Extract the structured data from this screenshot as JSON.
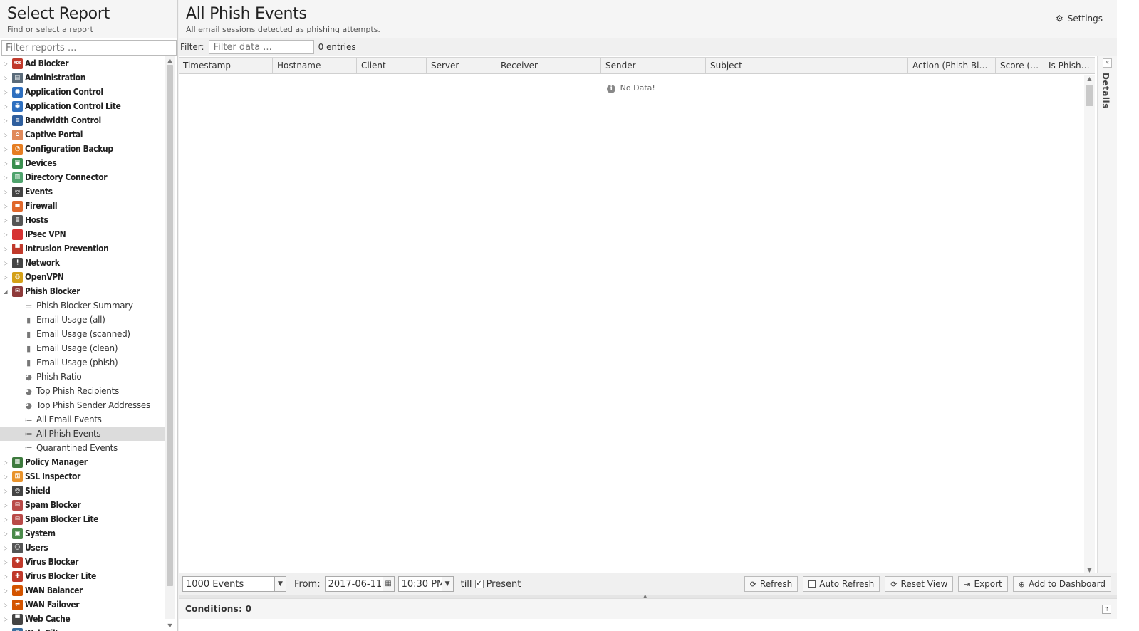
{
  "left": {
    "title": "Select Report",
    "subtitle": "Find or select a report",
    "filter_placeholder": "Filter reports ...",
    "categories_top": [
      {
        "label": "Ad Blocker",
        "icon": "ad-blocker-icon",
        "color": "#c0392b",
        "glyph": "ADS"
      },
      {
        "label": "Administration",
        "icon": "administration-icon",
        "color": "#5a6b7a",
        "glyph": "▤"
      },
      {
        "label": "Application Control",
        "icon": "application-control-icon",
        "color": "#2e6fbf",
        "glyph": "◉"
      },
      {
        "label": "Application Control Lite",
        "icon": "application-control-lite-icon",
        "color": "#2e6fbf",
        "glyph": "◉"
      },
      {
        "label": "Bandwidth Control",
        "icon": "bandwidth-control-icon",
        "color": "#2f5f9e",
        "glyph": "≡"
      },
      {
        "label": "Captive Portal",
        "icon": "captive-portal-icon",
        "color": "#e0895a",
        "glyph": "⌂"
      },
      {
        "label": "Configuration Backup",
        "icon": "configuration-backup-icon",
        "color": "#e67e22",
        "glyph": "◔"
      },
      {
        "label": "Devices",
        "icon": "devices-icon",
        "color": "#3a8f4f",
        "glyph": "▣"
      },
      {
        "label": "Directory Connector",
        "icon": "directory-connector-icon",
        "color": "#4fa36d",
        "glyph": "▥"
      },
      {
        "label": "Events",
        "icon": "events-icon",
        "color": "#444444",
        "glyph": "◎"
      },
      {
        "label": "Firewall",
        "icon": "firewall-icon",
        "color": "#e0682c",
        "glyph": "▬"
      },
      {
        "label": "Hosts",
        "icon": "hosts-icon",
        "color": "#555555",
        "glyph": "≣"
      },
      {
        "label": "IPsec VPN",
        "icon": "ipsec-vpn-icon",
        "color": "#d63333",
        "glyph": "🔒"
      },
      {
        "label": "Intrusion Prevention",
        "icon": "intrusion-prevention-icon",
        "color": "#c0392b",
        "glyph": "▀"
      },
      {
        "label": "Network",
        "icon": "network-icon",
        "color": "#444444",
        "glyph": "⋮"
      },
      {
        "label": "OpenVPN",
        "icon": "openvpn-icon",
        "color": "#d4a017",
        "glyph": "◍"
      },
      {
        "label": "Phish Blocker",
        "icon": "phish-blocker-icon",
        "color": "#8e3a3a",
        "glyph": "✉",
        "expanded": true
      }
    ],
    "phish_items": [
      {
        "label": "Phish Blocker Summary",
        "icon": "text-report-icon",
        "glyph": "☰"
      },
      {
        "label": "Email Usage (all)",
        "icon": "bar-chart-icon",
        "glyph": "▮"
      },
      {
        "label": "Email Usage (scanned)",
        "icon": "bar-chart-icon",
        "glyph": "▮"
      },
      {
        "label": "Email Usage (clean)",
        "icon": "bar-chart-icon",
        "glyph": "▮"
      },
      {
        "label": "Email Usage (phish)",
        "icon": "bar-chart-icon",
        "glyph": "▮"
      },
      {
        "label": "Phish Ratio",
        "icon": "pie-chart-icon",
        "glyph": "◕"
      },
      {
        "label": "Top Phish Recipients",
        "icon": "pie-chart-icon",
        "glyph": "◕"
      },
      {
        "label": "Top Phish Sender Addresses",
        "icon": "pie-chart-icon",
        "glyph": "◕"
      },
      {
        "label": "All Email Events",
        "icon": "event-list-icon",
        "glyph": "≔"
      },
      {
        "label": "All Phish Events",
        "icon": "event-list-icon",
        "glyph": "≔",
        "selected": true
      },
      {
        "label": "Quarantined Events",
        "icon": "event-list-icon",
        "glyph": "≔"
      }
    ],
    "categories_bottom": [
      {
        "label": "Policy Manager",
        "icon": "policy-manager-icon",
        "color": "#3d7a3d",
        "glyph": "▦"
      },
      {
        "label": "SSL Inspector",
        "icon": "ssl-inspector-icon",
        "color": "#e8932c",
        "glyph": "⚿"
      },
      {
        "label": "Shield",
        "icon": "shield-icon",
        "color": "#444444",
        "glyph": "◎"
      },
      {
        "label": "Spam Blocker",
        "icon": "spam-blocker-icon",
        "color": "#b94a48",
        "glyph": "✉"
      },
      {
        "label": "Spam Blocker Lite",
        "icon": "spam-blocker-lite-icon",
        "color": "#b94a48",
        "glyph": "✉"
      },
      {
        "label": "System",
        "icon": "system-icon",
        "color": "#4a8a4a",
        "glyph": "▣"
      },
      {
        "label": "Users",
        "icon": "users-icon",
        "color": "#555555",
        "glyph": "☺"
      },
      {
        "label": "Virus Blocker",
        "icon": "virus-blocker-icon",
        "color": "#c0392b",
        "glyph": "✚"
      },
      {
        "label": "Virus Blocker Lite",
        "icon": "virus-blocker-lite-icon",
        "color": "#c0392b",
        "glyph": "✚"
      },
      {
        "label": "WAN Balancer",
        "icon": "wan-balancer-icon",
        "color": "#d35400",
        "glyph": "⇌"
      },
      {
        "label": "WAN Failover",
        "icon": "wan-failover-icon",
        "color": "#d35400",
        "glyph": "⇌"
      },
      {
        "label": "Web Cache",
        "icon": "web-cache-icon",
        "color": "#444444",
        "glyph": "▀"
      },
      {
        "label": "Web Filter",
        "icon": "web-filter-icon",
        "color": "#3b6e9e",
        "glyph": "◍"
      }
    ]
  },
  "main": {
    "title": "All Phish Events",
    "subtitle": "All email sessions detected as phishing attempts.",
    "settings_label": "Settings",
    "filter_label": "Filter:",
    "filter_placeholder": "Filter data ...",
    "entries": "0 entries",
    "columns": [
      {
        "label": "Timestamp"
      },
      {
        "label": "Hostname"
      },
      {
        "label": "Client"
      },
      {
        "label": "Server"
      },
      {
        "label": "Receiver"
      },
      {
        "label": "Sender"
      },
      {
        "label": "Subject"
      },
      {
        "label": "Action (Phish Blocker)"
      },
      {
        "label": "Score (Phish Blocker)"
      },
      {
        "label": "Is Phish (Phish Blocker)"
      }
    ],
    "no_data": "No Data!",
    "details_label": "Details"
  },
  "toolbar": {
    "events_limit": "1000 Events",
    "from_label": "From:",
    "from_date": "2017-06-11",
    "from_time": "10:30 PM",
    "till_label": "till",
    "present_label": "Present",
    "present_checked": true,
    "refresh": "Refresh",
    "auto_refresh": "Auto Refresh",
    "reset_view": "Reset View",
    "export": "Export",
    "add_to_dashboard": "Add to Dashboard"
  },
  "conditions": {
    "label": "Conditions: 0"
  }
}
